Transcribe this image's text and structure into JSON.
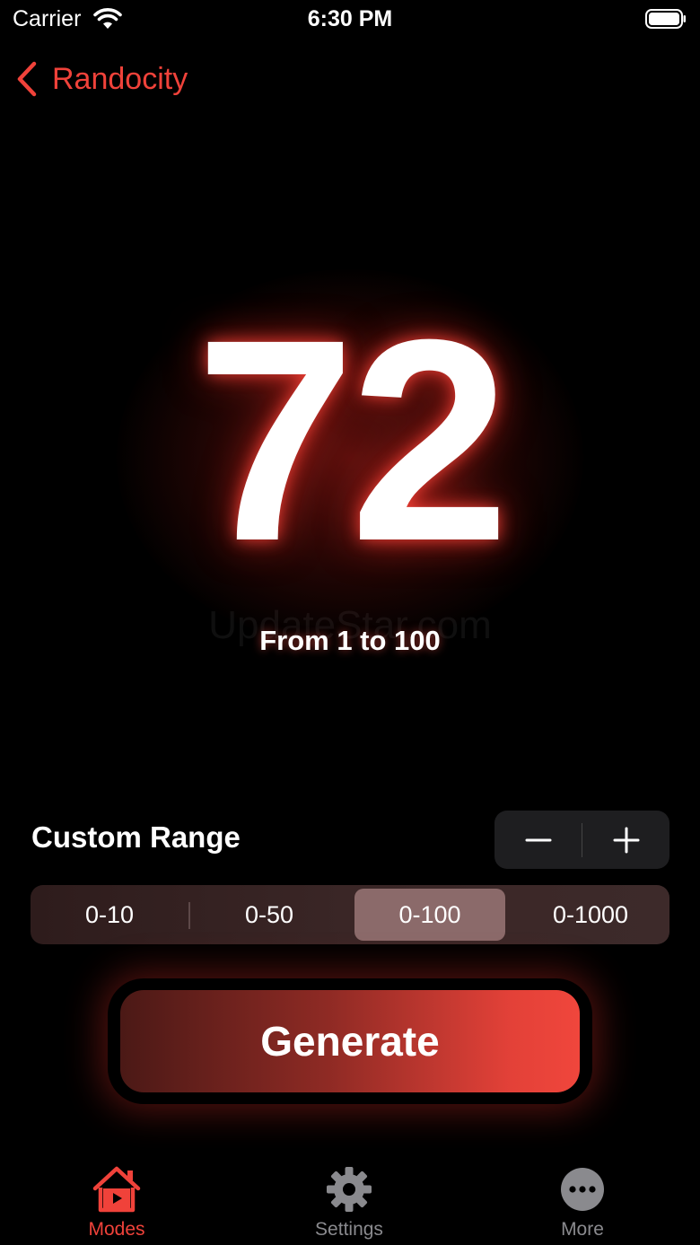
{
  "status_bar": {
    "carrier": "Carrier",
    "time": "6:30 PM"
  },
  "nav": {
    "back_label": "Randocity"
  },
  "display": {
    "number": "72",
    "watermark": "UpdateStar.com",
    "range_caption": "From 1 to 100"
  },
  "custom_range": {
    "label": "Custom Range"
  },
  "segments": {
    "items": [
      "0-10",
      "0-50",
      "0-100",
      "0-1000"
    ],
    "selected": "0-100"
  },
  "generate": {
    "label": "Generate"
  },
  "tabs": [
    {
      "label": "Modes",
      "icon": "house-play-icon",
      "active": true
    },
    {
      "label": "Settings",
      "icon": "gear-icon",
      "active": false
    },
    {
      "label": "More",
      "icon": "ellipsis-circle-icon",
      "active": false
    }
  ],
  "colors": {
    "accent": "#f0423a",
    "inactive_tab": "#8a8a8e",
    "background": "#000000"
  }
}
